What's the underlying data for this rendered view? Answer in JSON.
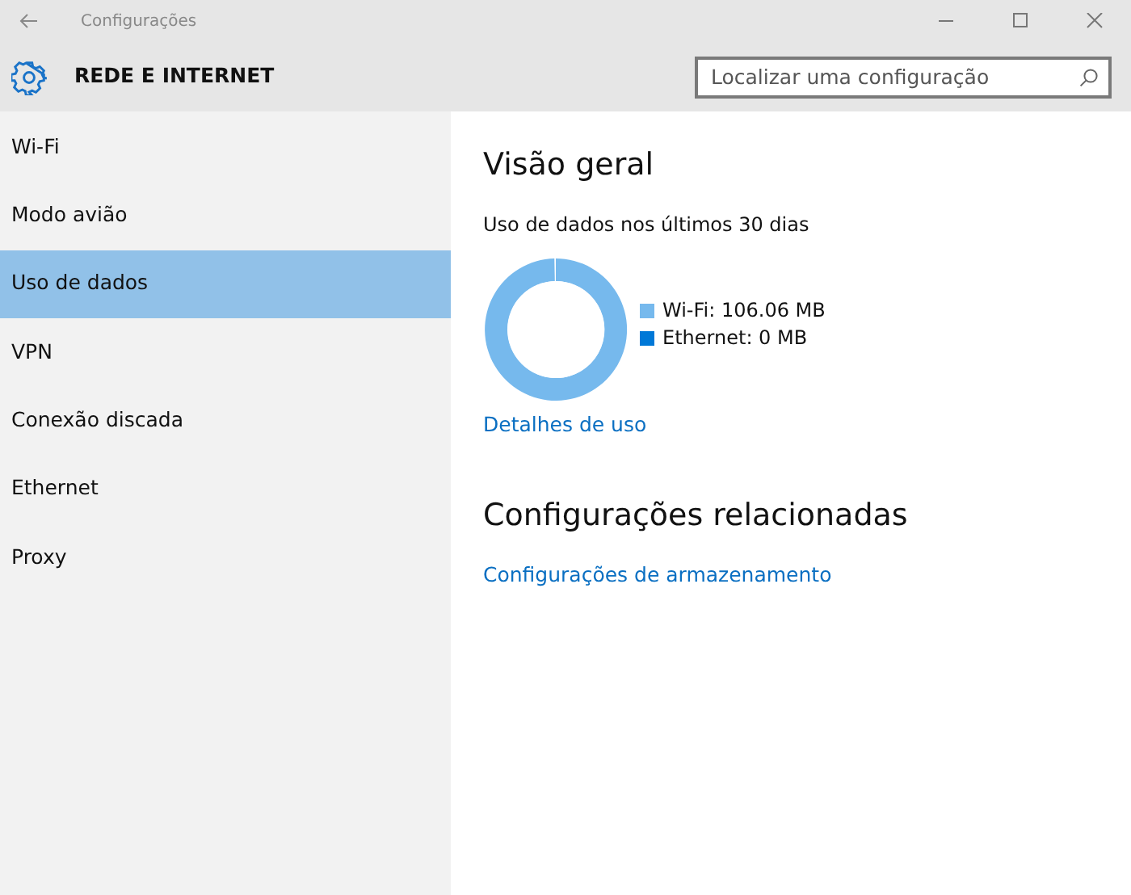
{
  "window": {
    "title": "Configurações"
  },
  "header": {
    "title": "REDE E INTERNET",
    "search": {
      "placeholder": "Localizar uma configuração"
    }
  },
  "sidebar": {
    "items": [
      {
        "label": "Wi-Fi",
        "selected": false
      },
      {
        "label": "Modo avião",
        "selected": false
      },
      {
        "label": "Uso de dados",
        "selected": true
      },
      {
        "label": "VPN",
        "selected": false
      },
      {
        "label": "Conexão discada",
        "selected": false
      },
      {
        "label": "Ethernet",
        "selected": false
      },
      {
        "label": "Proxy",
        "selected": false
      }
    ]
  },
  "overview": {
    "heading": "Visão geral",
    "subtitle": "Uso de dados nos últimos 30 dias",
    "chart_data": {
      "type": "donut",
      "categories": [
        "Wi-Fi: 106.06 MB",
        "Ethernet: 0 MB"
      ],
      "values": [
        100,
        0
      ]
    },
    "legend": [
      {
        "color": "#76b9ed"
      },
      {
        "color": "#0078d7"
      }
    ],
    "link": "Detalhes de uso"
  },
  "related": {
    "heading": "Configurações relacionadas",
    "links": [
      "Configurações de armazenamento"
    ]
  }
}
